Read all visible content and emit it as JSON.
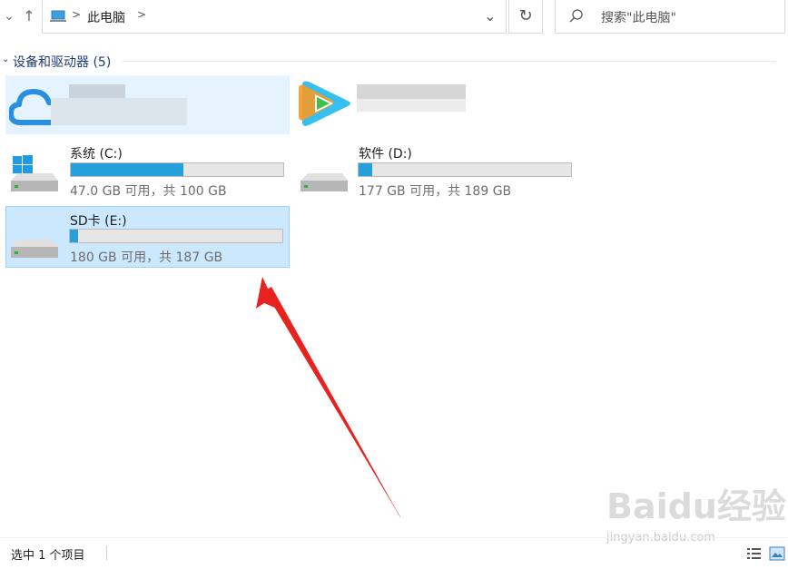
{
  "navbar": {
    "breadcrumb": "此电脑",
    "search_placeholder": "搜索\"此电脑\""
  },
  "group": {
    "title": "设备和驱动器 (5)"
  },
  "drives": [
    {
      "name": "系统 (C:)",
      "info": "47.0 GB 可用，共 100 GB",
      "used_fraction": 0.53
    },
    {
      "name": "软件 (D:)",
      "info": "177 GB 可用，共 189 GB",
      "used_fraction": 0.063
    },
    {
      "name": "SD卡 (E:)",
      "info": "180 GB 可用，共 187 GB",
      "used_fraction": 0.037
    }
  ],
  "status": {
    "text": "选中 1 个项目"
  },
  "watermark": {
    "brand": "Baidu经验",
    "url": "jingyan.baidu.com"
  },
  "colors": {
    "accent_fill": "#26a0da",
    "selected_bg": "#cce8ff",
    "annotation_arrow": "#e8231f"
  }
}
